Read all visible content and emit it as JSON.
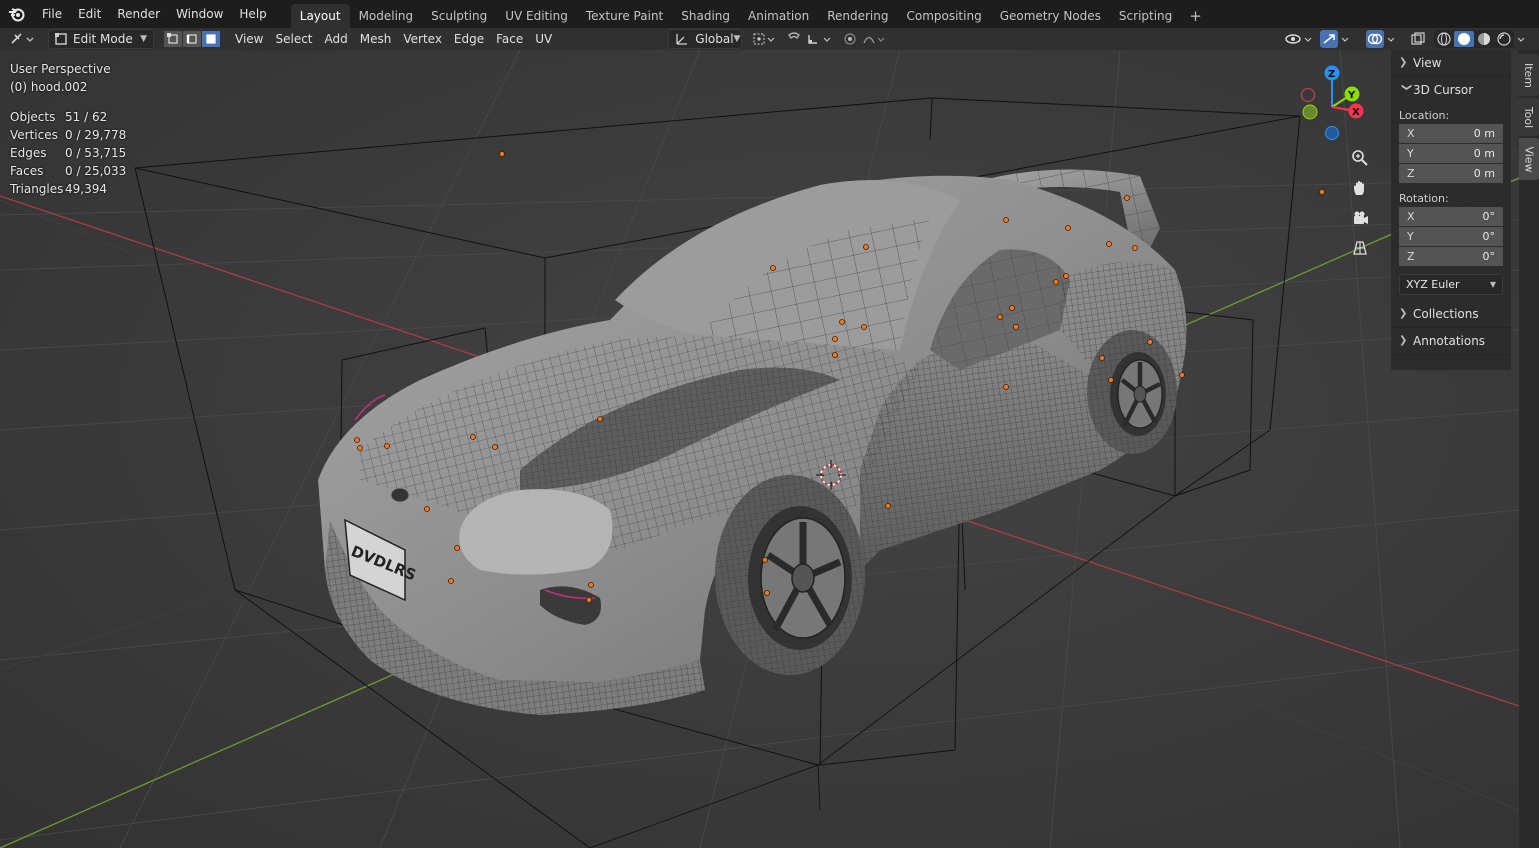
{
  "menu": [
    "File",
    "Edit",
    "Render",
    "Window",
    "Help"
  ],
  "workspaces": [
    "Layout",
    "Modeling",
    "Sculpting",
    "UV Editing",
    "Texture Paint",
    "Shading",
    "Animation",
    "Rendering",
    "Compositing",
    "Geometry Nodes",
    "Scripting"
  ],
  "active_workspace": "Layout",
  "header": {
    "mode": "Edit Mode",
    "menus": [
      "View",
      "Select",
      "Add",
      "Mesh",
      "Vertex",
      "Edge",
      "Face",
      "UV"
    ],
    "orientation": "Global"
  },
  "viewport": {
    "perspective": "User Perspective",
    "object": "(0) hood.002",
    "stats": [
      {
        "label": "Objects",
        "value": "51 / 62"
      },
      {
        "label": "Vertices",
        "value": "0 / 29,778"
      },
      {
        "label": "Edges",
        "value": "0 / 53,715"
      },
      {
        "label": "Faces",
        "value": "0 / 25,033"
      },
      {
        "label": "Triangles",
        "value": "49,394"
      }
    ],
    "plate_text": "DVDLRS"
  },
  "gizmo": {
    "x": "X",
    "y": "Y",
    "z": "Z"
  },
  "npanel": {
    "view": "View",
    "cursor": "3D Cursor",
    "location_label": "Location:",
    "location": [
      {
        "axis": "X",
        "value": "0 m"
      },
      {
        "axis": "Y",
        "value": "0 m"
      },
      {
        "axis": "Z",
        "value": "0 m"
      }
    ],
    "rotation_label": "Rotation:",
    "rotation": [
      {
        "axis": "X",
        "value": "0°"
      },
      {
        "axis": "Y",
        "value": "0°"
      },
      {
        "axis": "Z",
        "value": "0°"
      }
    ],
    "rotation_mode": "XYZ Euler",
    "collections": "Collections",
    "annotations": "Annotations"
  },
  "side_tabs": [
    "Item",
    "Tool",
    "View"
  ],
  "colors": {
    "accent": "#4772b3",
    "x_axis": "#ff3352",
    "y_axis": "#8bdc00",
    "z_axis": "#2890ff",
    "vertex": "#ff7a1a"
  }
}
